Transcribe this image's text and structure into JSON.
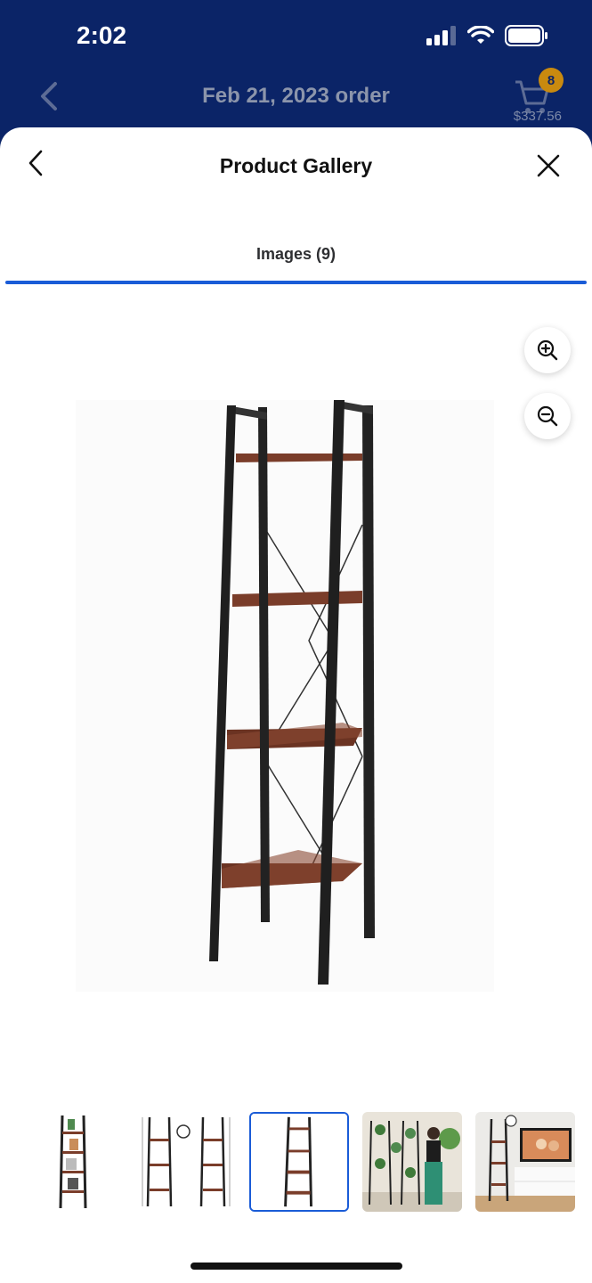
{
  "status_bar": {
    "time": "2:02"
  },
  "background_page": {
    "title": "Feb 21, 2023 order",
    "cart_count": "8",
    "cart_total": "$337.56"
  },
  "sheet": {
    "title": "Product Gallery",
    "tabs": [
      {
        "label": "Images (9)",
        "active": true
      }
    ]
  },
  "gallery": {
    "selected_index": 2,
    "thumbnails": [
      {
        "name": "ladder-shelf-with-items"
      },
      {
        "name": "ladder-shelf-dimensions"
      },
      {
        "name": "ladder-shelf-plain"
      },
      {
        "name": "ladder-shelf-with-plants"
      },
      {
        "name": "ladder-shelf-living-room"
      }
    ]
  },
  "colors": {
    "accent": "#1a5cd7",
    "header_bg": "#0b2467",
    "badge": "#c98a0f"
  }
}
